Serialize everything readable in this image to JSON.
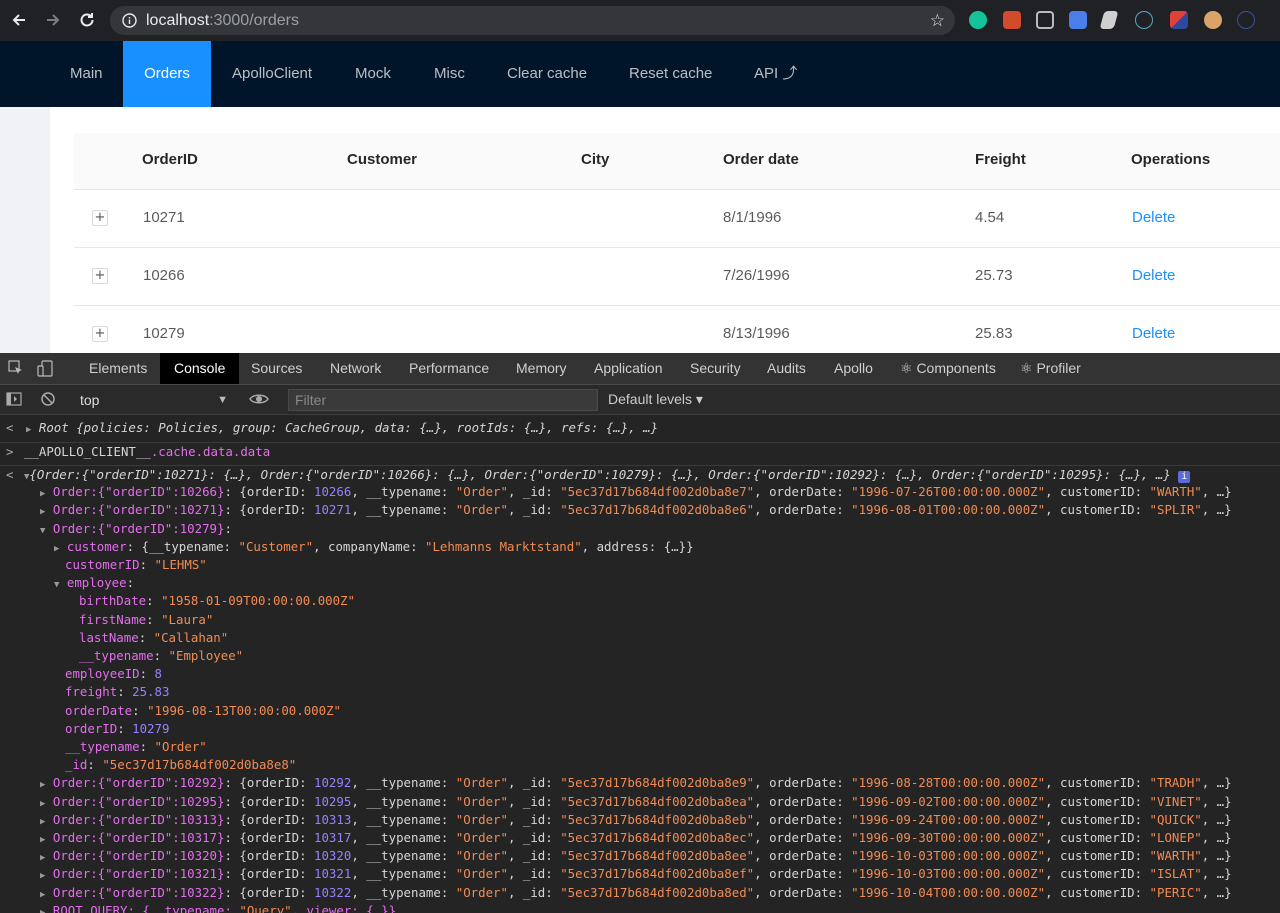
{
  "browser": {
    "url_host": "localhost",
    "url_path": ":3000/orders"
  },
  "nav": {
    "items": [
      {
        "label": "Main"
      },
      {
        "label": "Orders"
      },
      {
        "label": "ApolloClient"
      },
      {
        "label": "Mock"
      },
      {
        "label": "Misc"
      },
      {
        "label": "Clear cache"
      },
      {
        "label": "Reset cache"
      },
      {
        "label": "API ⤴"
      }
    ]
  },
  "table": {
    "headers": [
      "OrderID",
      "Customer",
      "City",
      "Order date",
      "Freight",
      "Operations"
    ],
    "rows": [
      {
        "order_id": "10271",
        "customer": "",
        "city": "",
        "order_date": "8/1/1996",
        "freight": "4.54",
        "operation": "Delete"
      },
      {
        "order_id": "10266",
        "customer": "",
        "city": "",
        "order_date": "7/26/1996",
        "freight": "25.73",
        "operation": "Delete"
      },
      {
        "order_id": "10279",
        "customer": "",
        "city": "",
        "order_date": "8/13/1996",
        "freight": "25.83",
        "operation": "Delete"
      }
    ]
  },
  "devtools": {
    "tabs": [
      "Elements",
      "Console",
      "Sources",
      "Network",
      "Performance",
      "Memory",
      "Application",
      "Security",
      "Audits",
      "Apollo",
      "⚛ Components",
      "⚛ Profiler"
    ],
    "context": "top",
    "filter_placeholder": "Filter",
    "levels": "Default levels ▾"
  },
  "console": {
    "root_line": "Root {policies: Policies, group: CacheGroup, data: {…}, rootIds: {…}, refs: {…}, …}",
    "command": "__APOLLO_CLIENT__.cache.data.data",
    "result_summary": "{Order:{\"orderID\":10271}: {…}, Order:{\"orderID\":10266}: {…}, Order:{\"orderID\":10279}: {…}, Order:{\"orderID\":10292}: {…}, Order:{\"orderID\":10295}: {…}, …}",
    "orders_collapsed_top": [
      {
        "key": "Order:{\"orderID\":10266}",
        "orderID": "10266",
        "_id": "5ec37d17b684df002d0ba8e7",
        "orderDate": "1996-07-26T00:00:00.000Z",
        "customerID": "WARTH"
      },
      {
        "key": "Order:{\"orderID\":10271}",
        "orderID": "10271",
        "_id": "5ec37d17b684df002d0ba8e6",
        "orderDate": "1996-08-01T00:00:00.000Z",
        "customerID": "SPLIR"
      }
    ],
    "expanded": {
      "key": "Order:{\"orderID\":10279}",
      "customer_line": "{__typename: \"Customer\", companyName: \"Lehmanns Marktstand\", address: {…}}",
      "customerID": "\"LEHMS\"",
      "employee": {
        "birthDate": "\"1958-01-09T00:00:00.000Z\"",
        "firstName": "\"Laura\"",
        "lastName": "\"Callahan\"",
        "typename": "\"Employee\""
      },
      "employeeID": "8",
      "freight": "25.83",
      "orderDate": "\"1996-08-13T00:00:00.000Z\"",
      "orderID": "10279",
      "typename": "\"Order\"",
      "_id": "\"5ec37d17b684df002d0ba8e8\""
    },
    "orders_collapsed_bottom": [
      {
        "key": "Order:{\"orderID\":10292}",
        "orderID": "10292",
        "_id": "5ec37d17b684df002d0ba8e9",
        "orderDate": "1996-08-28T00:00:00.000Z",
        "customerID": "TRADH"
      },
      {
        "key": "Order:{\"orderID\":10295}",
        "orderID": "10295",
        "_id": "5ec37d17b684df002d0ba8ea",
        "orderDate": "1996-09-02T00:00:00.000Z",
        "customerID": "VINET"
      },
      {
        "key": "Order:{\"orderID\":10313}",
        "orderID": "10313",
        "_id": "5ec37d17b684df002d0ba8eb",
        "orderDate": "1996-09-24T00:00:00.000Z",
        "customerID": "QUICK"
      },
      {
        "key": "Order:{\"orderID\":10317}",
        "orderID": "10317",
        "_id": "5ec37d17b684df002d0ba8ec",
        "orderDate": "1996-09-30T00:00:00.000Z",
        "customerID": "LONEP"
      },
      {
        "key": "Order:{\"orderID\":10320}",
        "orderID": "10320",
        "_id": "5ec37d17b684df002d0ba8ee",
        "orderDate": "1996-10-03T00:00:00.000Z",
        "customerID": "WARTH"
      },
      {
        "key": "Order:{\"orderID\":10321}",
        "orderID": "10321",
        "_id": "5ec37d17b684df002d0ba8ef",
        "orderDate": "1996-10-03T00:00:00.000Z",
        "customerID": "ISLAT"
      },
      {
        "key": "Order:{\"orderID\":10322}",
        "orderID": "10322",
        "_id": "5ec37d17b684df002d0ba8ed",
        "orderDate": "1996-10-04T00:00:00.000Z",
        "customerID": "PERIC"
      }
    ],
    "last_line": "ROOT_QUERY: {__typename: \"Query\", viewer: {…}}"
  }
}
